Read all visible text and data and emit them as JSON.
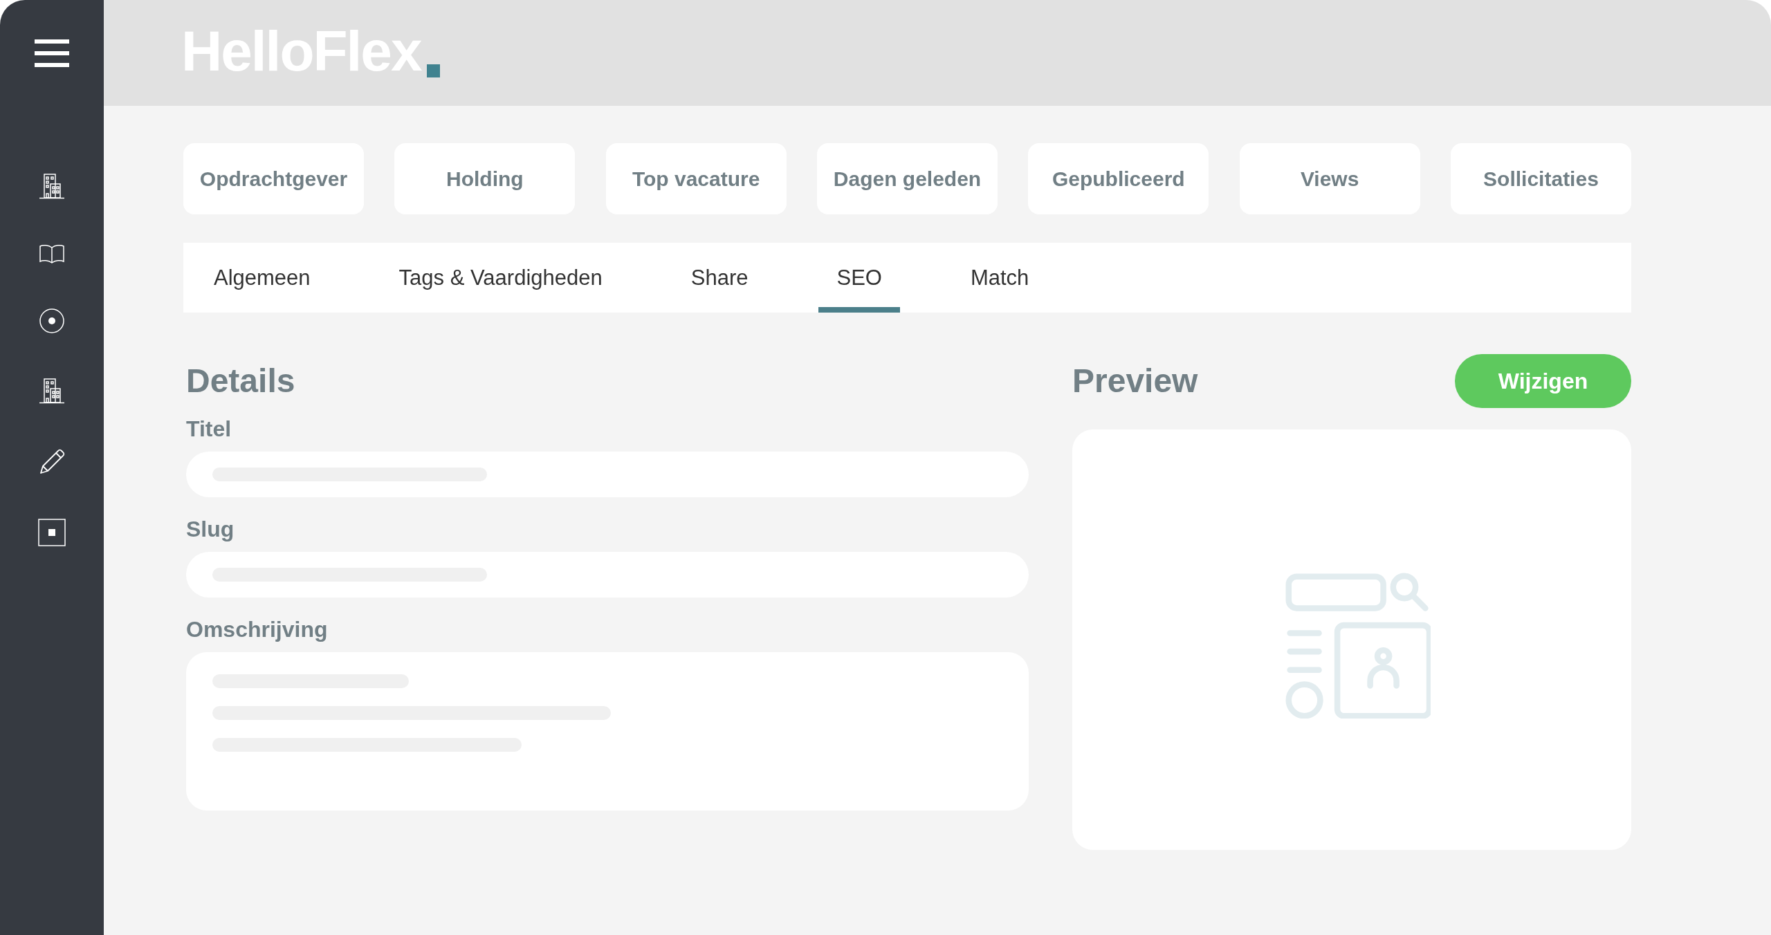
{
  "header": {
    "logo": "HelloFlex"
  },
  "stat_buttons": [
    "Opdrachtgever",
    "Holding",
    "Top vacature",
    "Dagen geleden",
    "Gepubliceerd",
    "Views",
    "Sollicitaties"
  ],
  "tabs": [
    {
      "label": "Algemeen",
      "selected": false
    },
    {
      "label": "Tags & Vaardigheden",
      "selected": false
    },
    {
      "label": "Share",
      "selected": false
    },
    {
      "label": "SEO",
      "selected": true
    },
    {
      "label": "Match",
      "selected": false
    }
  ],
  "details": {
    "title": "Details",
    "fields": [
      {
        "label": "Titel",
        "kind": "line"
      },
      {
        "label": "Slug",
        "kind": "line"
      },
      {
        "label": "Omschrijving",
        "kind": "area"
      }
    ]
  },
  "preview": {
    "title": "Preview",
    "button": "Wijzigen"
  }
}
